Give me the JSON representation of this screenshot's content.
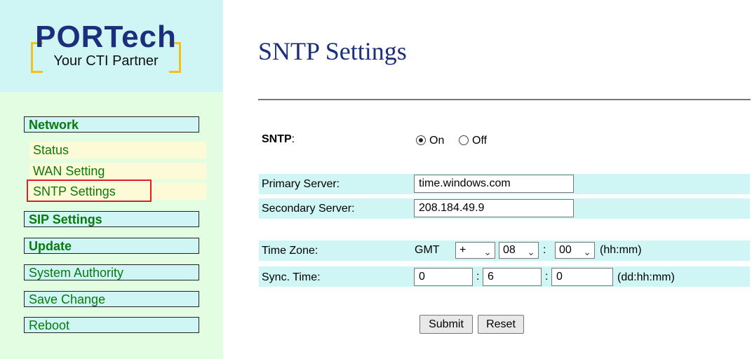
{
  "logo": {
    "brand": "PORTech",
    "tagline": "Your CTI Partner"
  },
  "sidebar": {
    "sections": [
      {
        "label": "Network"
      },
      {
        "label": "SIP Settings"
      },
      {
        "label": "Update"
      },
      {
        "label": "System Authority"
      },
      {
        "label": "Save Change"
      },
      {
        "label": "Reboot"
      }
    ],
    "network_items": [
      {
        "label": "Status"
      },
      {
        "label": "WAN Setting"
      },
      {
        "label": "SNTP Settings",
        "selected": true
      }
    ]
  },
  "page": {
    "title": "SNTP Settings"
  },
  "form": {
    "sntp_label": "SNTP",
    "sntp_colon": ":",
    "sntp_on": "On",
    "sntp_off": "Off",
    "sntp_value": "On",
    "primary_label": "Primary Server:",
    "primary_value": "time.windows.com",
    "secondary_label": "Secondary Server:",
    "secondary_value": "208.184.49.9",
    "tz_label": "Time Zone:",
    "tz_prefix": "GMT",
    "tz_sign": "+",
    "tz_hours": "08",
    "tz_minutes": "00",
    "tz_colon": ":",
    "tz_format": "(hh:mm)",
    "sync_label": "Sync. Time:",
    "sync_days": "0",
    "sync_hours": "6",
    "sync_minutes": "0",
    "sync_colon": ":",
    "sync_format": "(dd:hh:mm)",
    "submit_label": "Submit",
    "reset_label": "Reset"
  },
  "colors": {
    "sidebar_bg": "#e3fde3",
    "logo_bg": "#cff5f5",
    "nav_text": "#0b7a0b",
    "title": "#1c2f7c",
    "highlight": "#e01f1f"
  }
}
